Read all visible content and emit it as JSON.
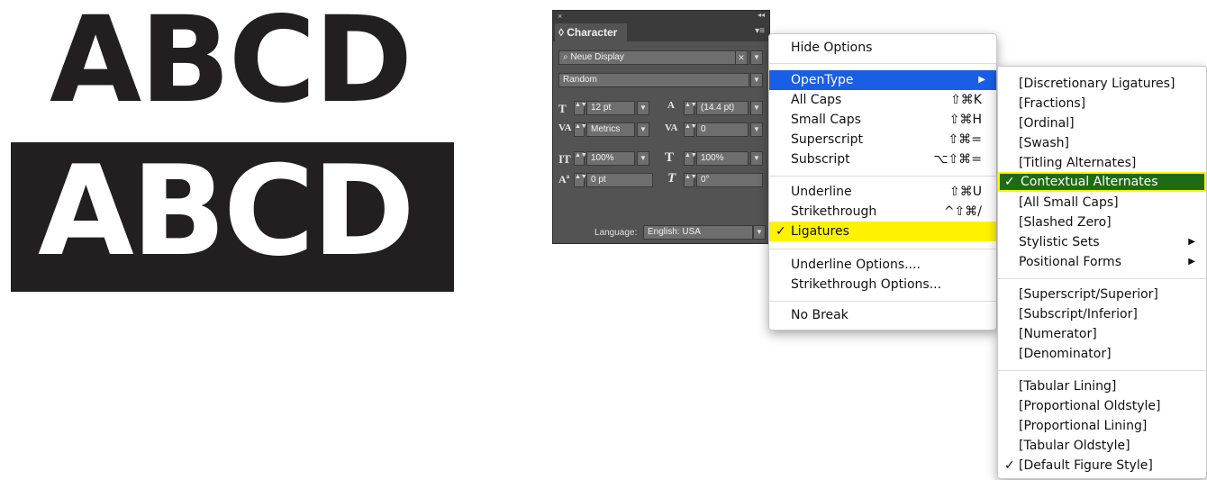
{
  "sample": {
    "top_text": "ABCD",
    "bottom_text": "ABCD"
  },
  "panel": {
    "close_glyph": "×",
    "collapse_glyph": "◂◂",
    "tab_label": "◊ Character",
    "menu_glyph": "▾≡",
    "font_family": "Neue Display",
    "font_style": "Random",
    "font_size": "12 pt",
    "leading": "(14.4 pt)",
    "kerning": "Metrics",
    "tracking": "0",
    "vertical_scale": "100%",
    "horizontal_scale": "100%",
    "baseline_shift": "0 pt",
    "skew": "0°",
    "language_label": "Language:",
    "language_value": "English: USA"
  },
  "menu1": {
    "items": [
      {
        "label": "Hide Options",
        "shortcut": ""
      },
      {
        "label": "OpenType",
        "shortcut": ""
      },
      {
        "label": "All Caps",
        "shortcut": "⇧⌘K"
      },
      {
        "label": "Small Caps",
        "shortcut": "⇧⌘H"
      },
      {
        "label": "Superscript",
        "shortcut": "⇧⌘="
      },
      {
        "label": "Subscript",
        "shortcut": "⌥⇧⌘="
      },
      {
        "label": "Underline",
        "shortcut": "⇧⌘U"
      },
      {
        "label": "Strikethrough",
        "shortcut": "^⇧⌘/"
      },
      {
        "label": "Ligatures",
        "shortcut": ""
      },
      {
        "label": "Underline Options....",
        "shortcut": ""
      },
      {
        "label": "Strikethrough Options...",
        "shortcut": ""
      },
      {
        "label": "No Break",
        "shortcut": ""
      }
    ]
  },
  "menu2": {
    "items": [
      "[Discretionary Ligatures]",
      "[Fractions]",
      "[Ordinal]",
      "[Swash]",
      "[Titling Alternates]",
      "Contextual Alternates",
      "[All Small Caps]",
      "[Slashed Zero]",
      "Stylistic Sets",
      "Positional Forms",
      "[Superscript/Superior]",
      "[Subscript/Inferior]",
      "[Numerator]",
      "[Denominator]",
      "[Tabular Lining]",
      "[Proportional Oldstyle]",
      "[Proportional Lining]",
      "[Tabular Oldstyle]",
      "[Default Figure Style]"
    ]
  },
  "glyphs": {
    "check": "✓",
    "submenu_arrow": "▶",
    "dropdown": "▼",
    "spin": "▲▼",
    "clear": "✕"
  },
  "colors": {
    "menu_active": "#1a5ee6",
    "highlight_yellow": "#fff200",
    "highlight_green": "#1f6b14",
    "panel_bg": "#535353"
  }
}
